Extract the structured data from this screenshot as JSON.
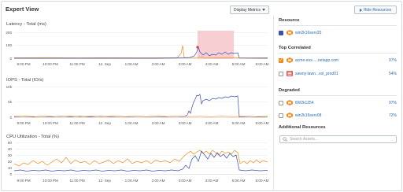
{
  "header": {
    "title": "Expert View",
    "display_metrics_label": "Display Metrics",
    "hide_resources_label": "Hide Resources"
  },
  "colors": {
    "blue": "#3b4fb0",
    "orange": "#f08c1e",
    "red": "#d9364a",
    "highlight": "#f5c2c7",
    "accent": "#2a6cb5"
  },
  "charts": [
    {
      "title": "Latency - Total (ms)",
      "yticks": [
        "200",
        "100",
        "0"
      ],
      "xticks": [
        "9:00 PM",
        "10:00 PM",
        "11:00 PM",
        "12. Sep",
        "1:00 AM",
        "2:00 AM",
        "3:00 AM",
        "4:00 AM",
        "5:00 AM",
        "6:00 AM"
      ]
    },
    {
      "title": "IOPS - Total (IO/s)",
      "yticks": [
        "10k",
        "5k",
        "0"
      ],
      "xticks": [
        "9:00 PM",
        "10:00 PM",
        "11:00 PM",
        "12. Sep",
        "1:00 AM",
        "2:00 AM",
        "3:00 AM",
        "4:00 AM",
        "5:00 AM",
        "6:00 AM"
      ]
    },
    {
      "title": "CPU Utilization - Total (%)",
      "yticks": [
        "50",
        "40",
        "30",
        "20",
        "10",
        "0"
      ],
      "xticks": [
        "9:00 PM",
        "10:00 PM",
        "11:00 PM",
        "12. Sep",
        "1:00 AM",
        "2:00 AM",
        "3:00 AM",
        "4:00 AM",
        "5:00 AM",
        "6:00 AM"
      ]
    }
  ],
  "sidebar": {
    "resource_title": "Resource",
    "resource_item": {
      "name": "win2k16serv35",
      "icon": "server-icon",
      "color": "#3b4fb0"
    },
    "top_correlated_title": "Top Correlated",
    "top_correlated": [
      {
        "name": "acme-esx-....netapp.com",
        "pct": "97%",
        "icon": "host-icon",
        "checked": true,
        "color": "#f08c1e"
      },
      {
        "name": "sawny:lawn...vol_prod01",
        "pct": "54%",
        "icon": "volume-icon",
        "checked": false,
        "color": "#e2574c"
      }
    ],
    "degraded_title": "Degraded",
    "degraded": [
      {
        "name": "tlW2k1254",
        "pct": "97%",
        "icon": "host-icon",
        "checked": false
      },
      {
        "name": "win2k16serv08",
        "pct": "72%",
        "icon": "host-icon",
        "checked": false
      }
    ],
    "additional_title": "Additional Resources",
    "search_placeholder": "Search Assets..."
  }
}
